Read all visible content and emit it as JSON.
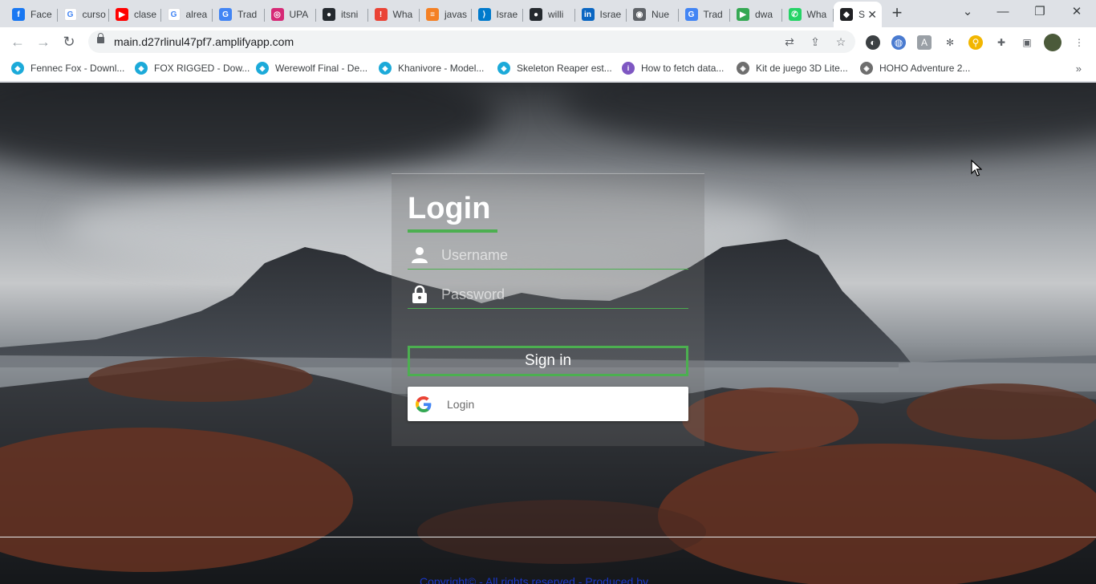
{
  "browser": {
    "tabs": [
      {
        "label": "Face",
        "icon": "facebook-icon",
        "color": "#1877f2",
        "glyph": "f"
      },
      {
        "label": "curso",
        "icon": "google-icon",
        "color": "#ffffff",
        "glyph": "G"
      },
      {
        "label": "clase",
        "icon": "youtube-icon",
        "color": "#ff0000",
        "glyph": "▶"
      },
      {
        "label": "alrea",
        "icon": "google-icon",
        "color": "#ffffff",
        "glyph": "G"
      },
      {
        "label": "Trad",
        "icon": "translate-icon",
        "color": "#4285f4",
        "glyph": "G"
      },
      {
        "label": "UPA",
        "icon": "instagram-icon",
        "color": "#d62976",
        "glyph": "◎"
      },
      {
        "label": "itsni",
        "icon": "github-icon",
        "color": "#24292e",
        "glyph": "●"
      },
      {
        "label": "Wha",
        "icon": "warning-icon",
        "color": "#ea4335",
        "glyph": "!"
      },
      {
        "label": "javas",
        "icon": "stackoverflow-icon",
        "color": "#f48024",
        "glyph": "≡"
      },
      {
        "label": "Israe",
        "icon": "vscode-icon",
        "color": "#007acc",
        "glyph": "⟩"
      },
      {
        "label": "willi",
        "icon": "github-icon",
        "color": "#24292e",
        "glyph": "●"
      },
      {
        "label": "Israe",
        "icon": "linkedin-icon",
        "color": "#0a66c2",
        "glyph": "in"
      },
      {
        "label": "Nue",
        "icon": "chrome-icon",
        "color": "#5f6368",
        "glyph": "◉"
      },
      {
        "label": "Trad",
        "icon": "translate-icon",
        "color": "#4285f4",
        "glyph": "G"
      },
      {
        "label": "dwa",
        "icon": "play-icon",
        "color": "#34a853",
        "glyph": "▶"
      },
      {
        "label": "Wha",
        "icon": "whatsapp-icon",
        "color": "#25d366",
        "glyph": "✆"
      },
      {
        "label": "S",
        "icon": "site-icon",
        "color": "#202124",
        "glyph": "◆",
        "active": true
      }
    ],
    "url": "main.d27rlinul47pf7.amplifyapp.com",
    "bookmarks": [
      {
        "label": "Fennec Fox - Downl...",
        "icon": "sketchfab-icon",
        "color": "#1caad9"
      },
      {
        "label": "FOX RIGGED - Dow...",
        "icon": "sketchfab-icon",
        "color": "#1caad9"
      },
      {
        "label": "Werewolf Final - De...",
        "icon": "sketchfab-icon",
        "color": "#1caad9"
      },
      {
        "label": "Khanivore - Model...",
        "icon": "sketchfab-icon",
        "color": "#1caad9"
      },
      {
        "label": "Skeleton Reaper est...",
        "icon": "sketchfab-icon",
        "color": "#1caad9"
      },
      {
        "label": "How to fetch data...",
        "icon": "info-icon",
        "color": "#7e57c2"
      },
      {
        "label": "Kit de juego 3D Lite...",
        "icon": "unity-icon",
        "color": "#6e6e6e"
      },
      {
        "label": "HOHO Adventure 2...",
        "icon": "unity-icon",
        "color": "#6e6e6e"
      }
    ]
  },
  "login": {
    "title": "Login",
    "username_placeholder": "Username",
    "password_placeholder": "Password",
    "signin_label": "Sign in",
    "google_label": "Login"
  },
  "footer": {
    "text": "Copyright© - All rights reserved - Produced by"
  },
  "colors": {
    "accent": "#4caf50",
    "footer_link": "#1a37c8"
  }
}
